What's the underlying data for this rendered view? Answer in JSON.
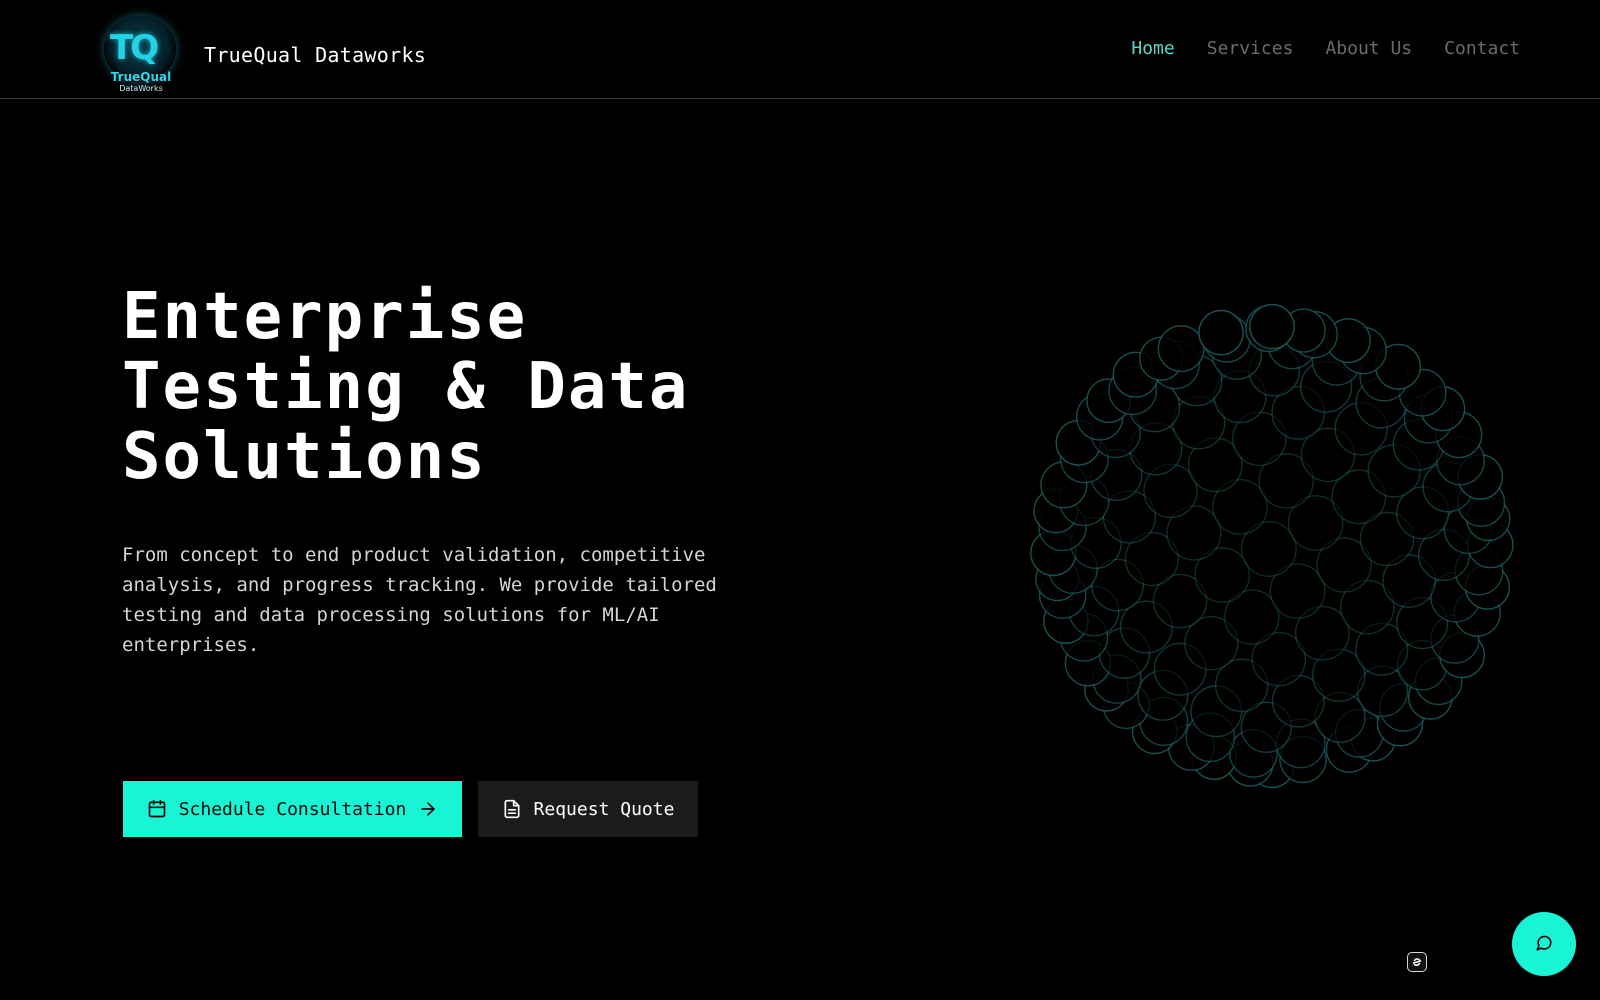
{
  "brand": {
    "name": "TrueQual Dataworks",
    "logo_mark": "TQ",
    "logo_line1": "TrueQual",
    "logo_line2": "DataWorks"
  },
  "nav": {
    "items": [
      {
        "label": "Home",
        "active": true
      },
      {
        "label": "Services",
        "active": false
      },
      {
        "label": "About Us",
        "active": false
      },
      {
        "label": "Contact",
        "active": false
      }
    ]
  },
  "hero": {
    "title_lines": [
      "Enterprise",
      "Testing & Data",
      "Solutions"
    ],
    "description": "From concept to end product validation, competitive analysis, and progress tracking. We provide tailored testing and data processing solutions for ML/AI enterprises."
  },
  "actions": {
    "primary_label": "Schedule Consultation",
    "primary_icon": "calendar-icon",
    "primary_trailing_icon": "arrow-right-icon",
    "secondary_label": "Request Quote",
    "secondary_icon": "document-icon"
  },
  "widgets": {
    "chat_icon": "chat-bubble-icon",
    "badge_icon": "link-badge-icon"
  },
  "colors": {
    "accent": "#19f5d4",
    "nav_active": "#5fd3c4",
    "nav_inactive": "#6b6b6b",
    "background": "#000000",
    "secondary_button": "#1b1b1b",
    "sphere_outline": "#1f5a5a"
  }
}
